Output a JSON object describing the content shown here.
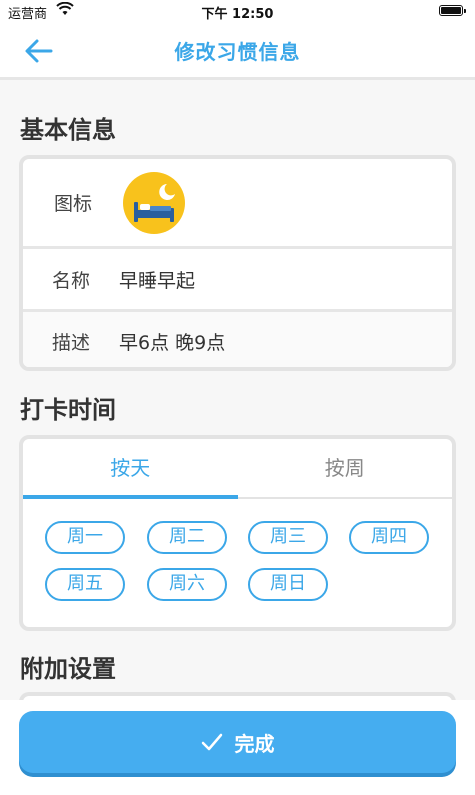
{
  "status_bar": {
    "carrier": "运营商",
    "time": "下午 12:50"
  },
  "nav": {
    "title": "修改习惯信息"
  },
  "basic_info": {
    "section_title": "基本信息",
    "icon_label": "图标",
    "name_label": "名称",
    "name_value": "早睡早起",
    "desc_label": "描述",
    "desc_value": "早6点 晚9点"
  },
  "checkin_time": {
    "section_title": "打卡时间",
    "tabs": [
      {
        "label": "按天",
        "active": true
      },
      {
        "label": "按周",
        "active": false
      }
    ],
    "days": [
      "周一",
      "周二",
      "周三",
      "周四",
      "周五",
      "周六",
      "周日"
    ]
  },
  "extra": {
    "section_title": "附加设置"
  },
  "footer": {
    "done_label": "完成"
  },
  "colors": {
    "accent": "#3ba7e8",
    "icon_bg": "#f8c21c",
    "button_bg": "#45adf0"
  }
}
